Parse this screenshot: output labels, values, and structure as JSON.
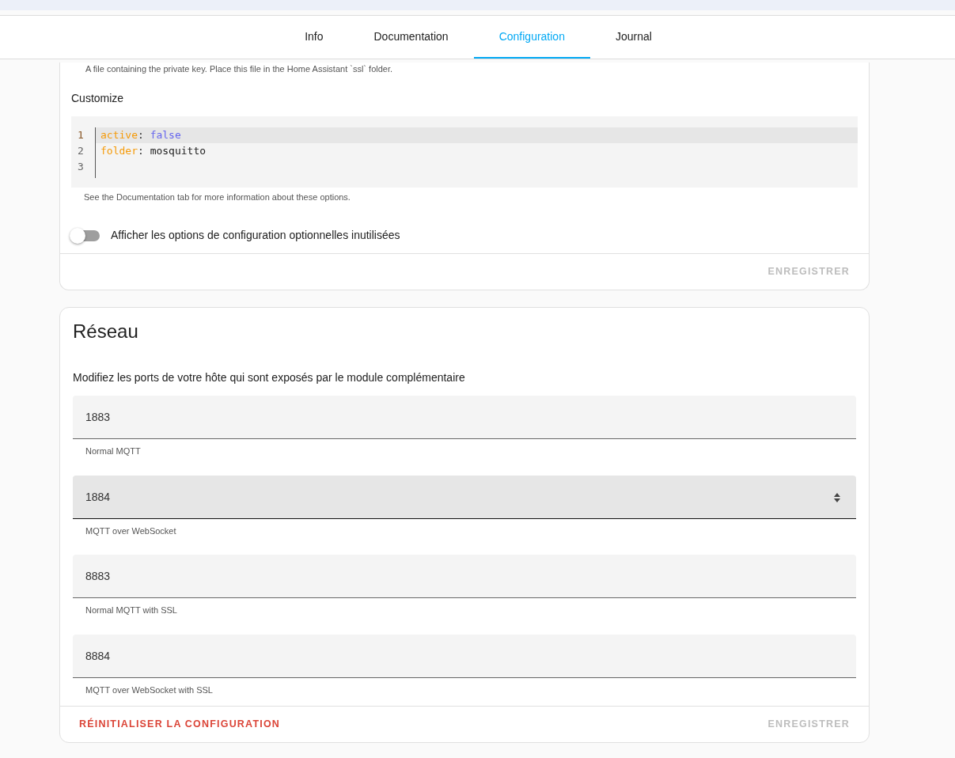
{
  "tabs": [
    {
      "label": "Info",
      "selected": false
    },
    {
      "label": "Documentation",
      "selected": false
    },
    {
      "label": "Configuration",
      "selected": true
    },
    {
      "label": "Journal",
      "selected": false
    }
  ],
  "options_card": {
    "key_helper": "A file containing the private key. Place this file in the Home Assistant `ssl` folder.",
    "customize_label": "Customize",
    "code_lines": [
      {
        "number": "1",
        "active": true,
        "tokens": [
          {
            "kind": "key",
            "text": "active"
          },
          {
            "kind": "punct",
            "text": ": "
          },
          {
            "kind": "bool",
            "text": "false"
          }
        ]
      },
      {
        "number": "2",
        "active": false,
        "tokens": [
          {
            "kind": "key",
            "text": "folder"
          },
          {
            "kind": "punct",
            "text": ": "
          },
          {
            "kind": "plain",
            "text": "mosquitto"
          }
        ]
      },
      {
        "number": "3",
        "active": false
      }
    ],
    "code_helper": "See the Documentation tab for more information about these options.",
    "toggle": {
      "label": "Afficher les options de configuration optionnelles inutilisées",
      "on": false
    },
    "save_button": {
      "label": "ENREGISTRER",
      "disabled": true
    }
  },
  "network_card": {
    "title": "Réseau",
    "description": "Modifiez les ports de votre hôte qui sont exposés par le module complémentaire",
    "fields": [
      {
        "value": "1883",
        "helper": "Normal MQTT",
        "hovered": false
      },
      {
        "value": "1884",
        "helper": "MQTT over WebSocket",
        "hovered": true
      },
      {
        "value": "8883",
        "helper": "Normal MQTT with SSL",
        "hovered": false
      },
      {
        "value": "8884",
        "helper": "MQTT over WebSocket with SSL",
        "hovered": false
      }
    ],
    "reset_button": {
      "label": "RÉINITIALISER LA CONFIGURATION"
    },
    "save_button": {
      "label": "ENREGISTRER",
      "disabled": true
    }
  }
}
